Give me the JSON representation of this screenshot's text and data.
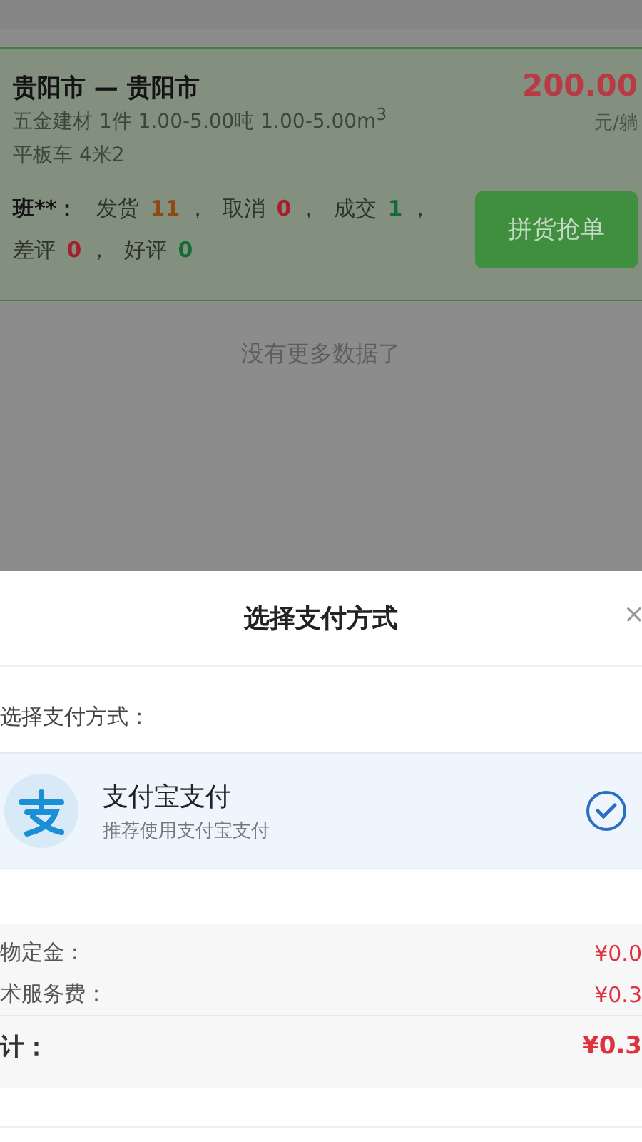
{
  "order": {
    "route": "贵阳市 — 贵阳市",
    "price": "200.00",
    "unit": "元/躺",
    "cargo": "五金建材 1件 1.00-5.00吨 1.00-5.00m$^{3}$",
    "vehicle": "平板车 4米2",
    "shipper": "班**：",
    "stats": [
      {
        "label": "发货",
        "value": "11",
        "color": "#8f4a10",
        "sep": "，"
      },
      {
        "label": "取消",
        "value": "0",
        "color": "#a3202c",
        "sep": "，"
      },
      {
        "label": "成交",
        "value": "1",
        "color": "#146b38",
        "sep": "，"
      },
      {
        "label": "差评",
        "value": "0",
        "color": "#a3202c",
        "sep": "，"
      },
      {
        "label": "好评",
        "value": "0",
        "color": "#146b38"
      }
    ],
    "action": "拼货抢单"
  },
  "list_end": "没有更多数据了",
  "sheet": {
    "title": "选择支付方式",
    "close": "×",
    "prompt": "选择支付方式：",
    "methods": [
      {
        "name": "支付宝支付",
        "hint": "推荐使用支付宝支付",
        "selected": true
      }
    ],
    "fees": [
      {
        "label": "物定金：",
        "amount": "¥0.0",
        "kind": "line"
      },
      {
        "label": "术服务费：",
        "amount": "¥0.3",
        "kind": "line"
      },
      {
        "label": "计：",
        "amount": "¥0.3",
        "kind": "total"
      }
    ]
  }
}
